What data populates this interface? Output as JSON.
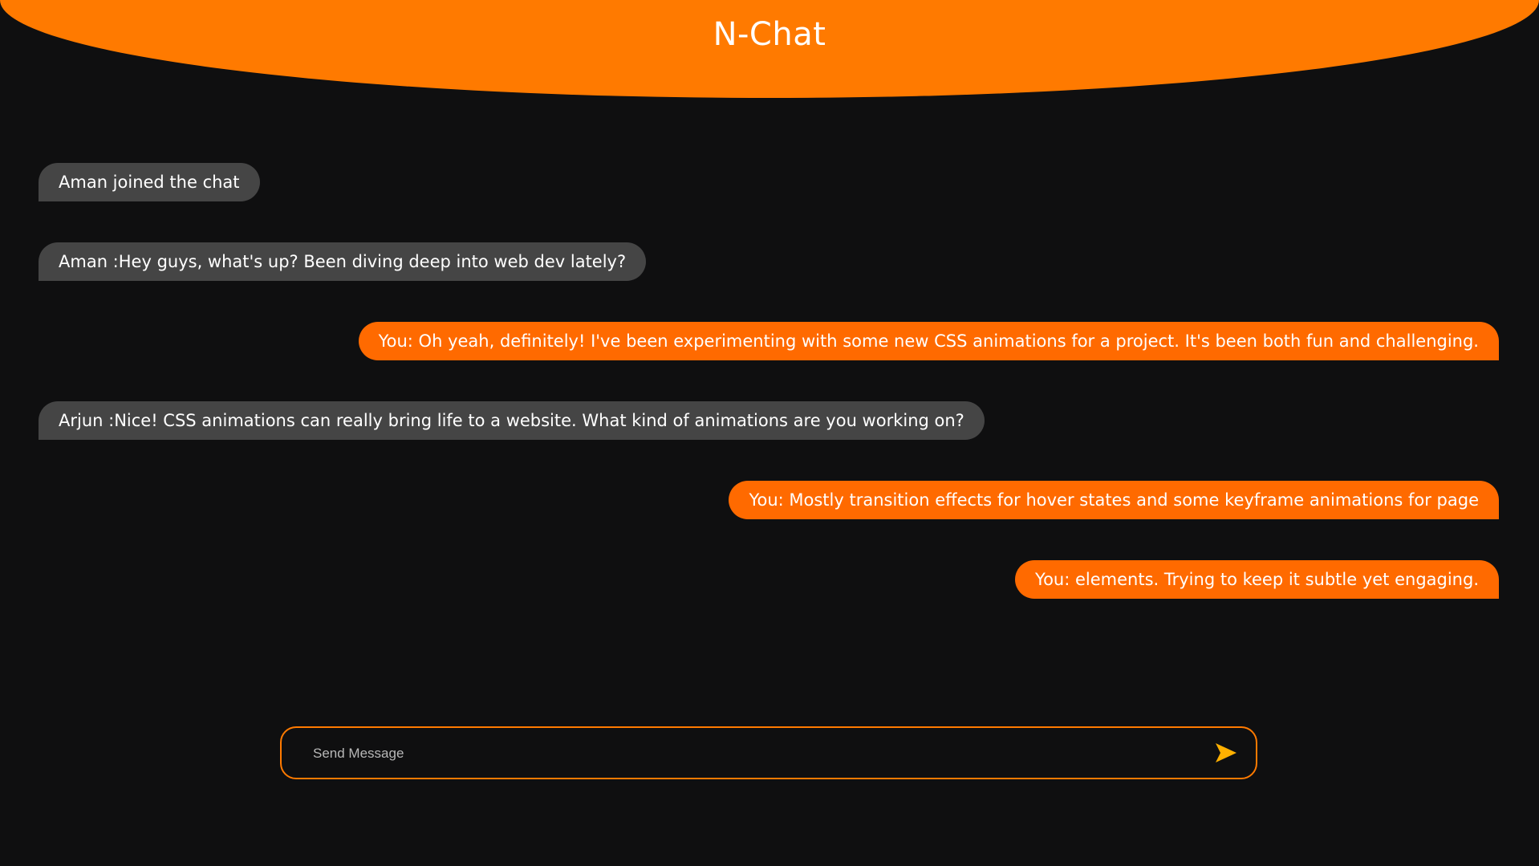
{
  "header": {
    "title": "N-Chat"
  },
  "messages": [
    {
      "type": "incoming",
      "text": "Aman joined the chat"
    },
    {
      "type": "incoming",
      "text": "Aman :Hey guys, what's up? Been diving deep into web dev lately?"
    },
    {
      "type": "outgoing",
      "text": "You: Oh yeah, definitely! I've been experimenting with some new CSS animations for a project. It's been both fun and challenging."
    },
    {
      "type": "incoming",
      "text": "Arjun :Nice! CSS animations can really bring life to a website. What kind of animations are you working on?"
    },
    {
      "type": "outgoing",
      "text": "You: Mostly transition effects for hover states and some keyframe animations for page"
    },
    {
      "type": "outgoing",
      "text": "You: elements. Trying to keep it subtle yet engaging."
    }
  ],
  "composer": {
    "placeholder": "Send Message",
    "value": "",
    "send_icon": "send-arrow-icon"
  },
  "colors": {
    "accent": "#ff7a00",
    "outgoing_bubble": "#ff6a00",
    "incoming_bubble": "#454545",
    "background": "#0f0f10",
    "send_icon": "#ffb000"
  }
}
